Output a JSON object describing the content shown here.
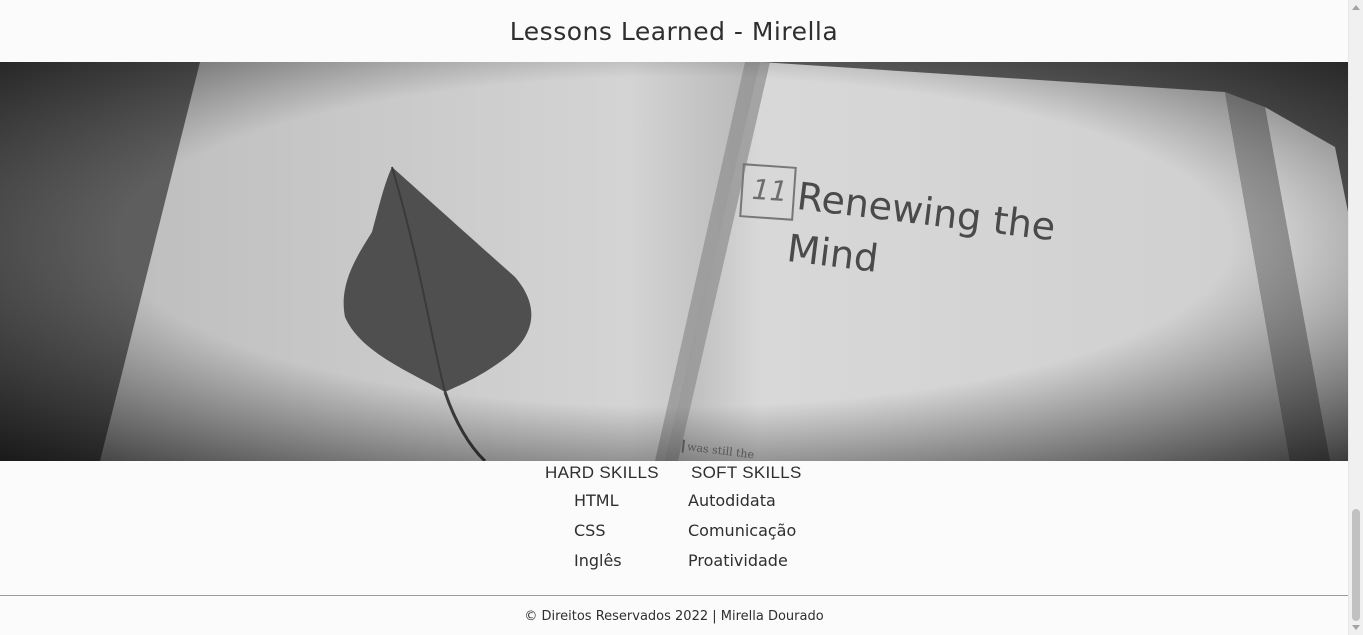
{
  "header": {
    "title": "Lessons Learned - Mirella"
  },
  "hero": {
    "chapter_number": "11",
    "chapter_title_line1": "Renewing the",
    "chapter_title_line2": "Mind",
    "book_text_fragment": "was still the"
  },
  "skills": {
    "hard": {
      "heading": "HARD SKILLS",
      "items": [
        "HTML",
        "CSS",
        "Inglês"
      ]
    },
    "soft": {
      "heading": "SOFT SKILLS",
      "items": [
        "Autodidata",
        "Comunicação",
        "Proatividade"
      ]
    }
  },
  "footer": {
    "copyright": "© Direitos Reservados 2022 | Mirella Dourado"
  },
  "colors": {
    "background": "#fcfbfb",
    "text": "#2f2f2f",
    "divider": "#9a9a9a"
  }
}
